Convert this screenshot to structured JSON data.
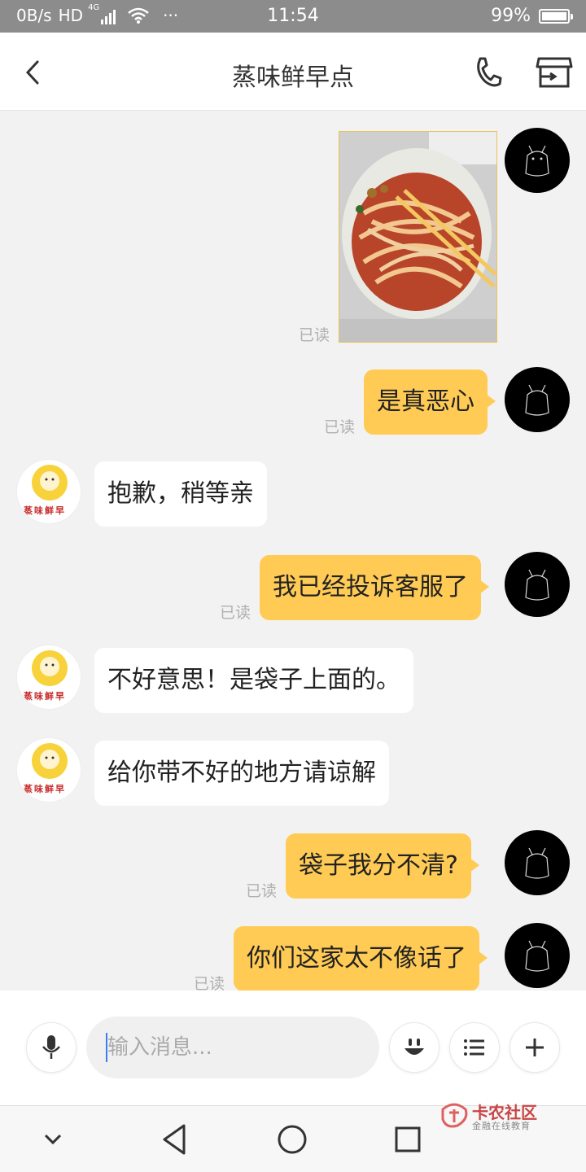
{
  "status_bar": {
    "net_speed": "0B/s",
    "hd": "HD",
    "signal_type": "4G",
    "more": "···",
    "time": "11:54",
    "battery_percent": "99%"
  },
  "header": {
    "title": "蒸味鲜早点",
    "back_icon": "chevron-left-icon",
    "phone_icon": "phone-icon",
    "shop_icon": "shop-icon"
  },
  "shop_logo_text": "蒸味鲜早",
  "messages": [
    {
      "from": "me",
      "type": "image",
      "image_desc": "noodle-photo",
      "status": "已读"
    },
    {
      "from": "me",
      "text": "是真恶心",
      "status": "已读"
    },
    {
      "from": "shop",
      "text": "抱歉，稍等亲"
    },
    {
      "from": "me",
      "text": "我已经投诉客服了",
      "status": "已读"
    },
    {
      "from": "shop",
      "text": "不好意思！是袋子上面的。"
    },
    {
      "from": "shop",
      "text": "给你带不好的地方请谅解"
    },
    {
      "from": "me",
      "text": "袋子我分不清?",
      "status": "已读"
    },
    {
      "from": "me",
      "text": "你们这家太不像话了",
      "status": "已读"
    }
  ],
  "input_bar": {
    "placeholder": "输入消息...",
    "voice_icon": "microphone-icon",
    "emoji_icon": "emoji-icon",
    "menu_icon": "list-icon",
    "add_icon": "plus-icon"
  },
  "watermark": {
    "title": "卡农社区",
    "subtitle": "金融在线教育"
  },
  "colors": {
    "my_bubble": "#ffcb55",
    "shop_bubble": "#ffffff",
    "chat_bg": "#f2f2f2",
    "status_bar": "#8c8c8c"
  }
}
